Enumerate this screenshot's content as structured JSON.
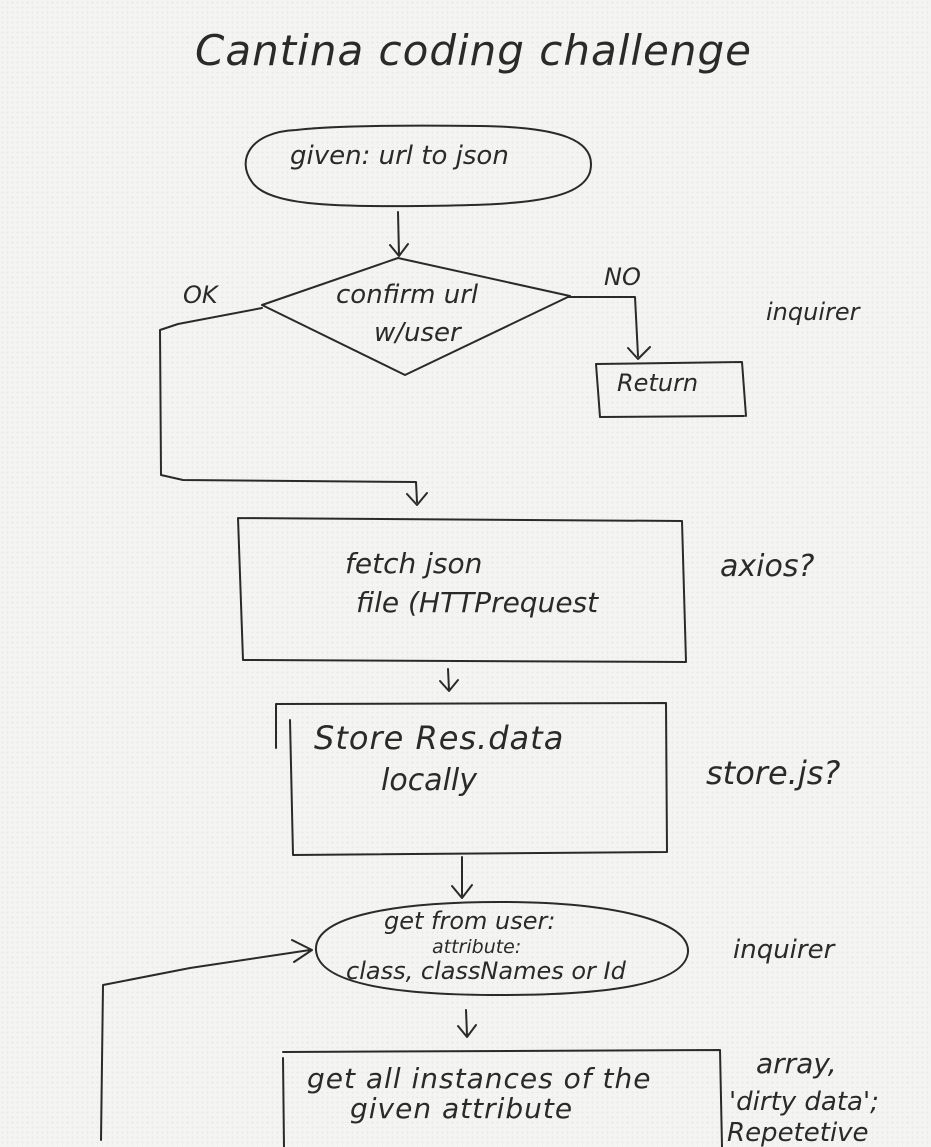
{
  "title": "Cantina coding challenge",
  "nodes": {
    "start": "given: url to json",
    "decision": {
      "line1": "confirm url",
      "line2": "w/user"
    },
    "return_box": "Return",
    "fetch": {
      "line1": "fetch json",
      "line2": "file (HTTPrequest"
    },
    "store": {
      "line1": "Store Res.data",
      "line2": "locally"
    },
    "get_attr": {
      "line1": "get from user:",
      "line2": "attribute:",
      "line3": "class, classNames or Id"
    },
    "get_all": {
      "line1": "get all instances of the",
      "line2": "given attribute"
    }
  },
  "branches": {
    "ok": "OK",
    "no": "NO"
  },
  "notes": {
    "inquirer_1": "inquirer",
    "axios": "axios?",
    "store_js": "store.js?",
    "inquirer_2": "inquirer",
    "array_line1": "array,",
    "array_line2": "'dirty data';",
    "array_line3": "Repetetive"
  }
}
